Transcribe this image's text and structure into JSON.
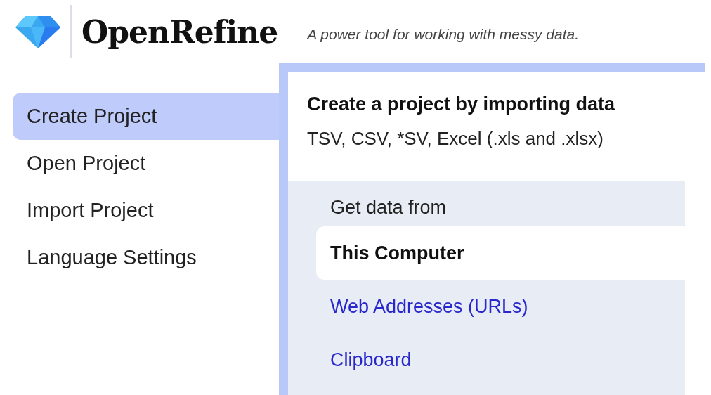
{
  "app": {
    "name": "OpenRefine",
    "tagline": "A power tool for working with messy data."
  },
  "sidebar": {
    "items": [
      {
        "label": "Create Project",
        "selected": true
      },
      {
        "label": "Open Project",
        "selected": false
      },
      {
        "label": "Import Project",
        "selected": false
      },
      {
        "label": "Language Settings",
        "selected": false
      }
    ]
  },
  "panel": {
    "title": "Create a project by importing data",
    "formats": "TSV, CSV, *SV, Excel (.xls and .xlsx)",
    "source_heading": "Get data from",
    "sources": [
      {
        "label": "This Computer",
        "selected": true
      },
      {
        "label": "Web Addresses (URLs)",
        "selected": false
      },
      {
        "label": "Clipboard",
        "selected": false
      }
    ]
  }
}
